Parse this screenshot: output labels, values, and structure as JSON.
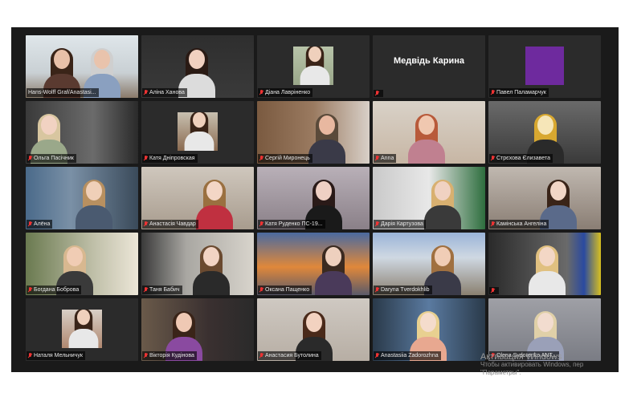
{
  "window_title": "",
  "participants": [
    {
      "name": "Hans-Wolff Graf/Anastasi...",
      "muted": false,
      "active": true
    },
    {
      "name": "Аліна Ханова",
      "muted": true
    },
    {
      "name": "Діана Лавріненко",
      "muted": true
    },
    {
      "name": "",
      "muted": true,
      "display_name": "Медвідь Карина"
    },
    {
      "name": "Павел Паламарчук",
      "muted": true
    },
    {
      "name": "Ольга Пасічник",
      "muted": true
    },
    {
      "name": "Катя Дніпровская",
      "muted": true
    },
    {
      "name": "Сергій Миронець",
      "muted": true
    },
    {
      "name": "Anna",
      "muted": true
    },
    {
      "name": "Стрєхова Єлизавета",
      "muted": true
    },
    {
      "name": "Алёна",
      "muted": true
    },
    {
      "name": "Анастасія Чавдар",
      "muted": true
    },
    {
      "name": "Катя Руденко ПС-19...",
      "muted": true
    },
    {
      "name": "Дарія Картузова",
      "muted": true
    },
    {
      "name": "Камінська Ангеліна",
      "muted": true
    },
    {
      "name": "Богдана Боброва",
      "muted": true
    },
    {
      "name": "Таня Бабич",
      "muted": true
    },
    {
      "name": "Оксана Пащенко",
      "muted": true
    },
    {
      "name": "Daryna Tverdokhlib",
      "muted": true
    },
    {
      "name": "",
      "muted": true
    },
    {
      "name": "Наталя Мельничук",
      "muted": true
    },
    {
      "name": "Вікторія Кудінова",
      "muted": true
    },
    {
      "name": "Анастасия Бутолина",
      "muted": true
    },
    {
      "name": "Anastasiia Zadorozhna",
      "muted": true
    },
    {
      "name": "Olena Sydorenko ANT...",
      "muted": true
    }
  ],
  "watermark": {
    "title": "Активация Windows",
    "line1": "Чтобы активировать Windows, пер",
    "line2": "\"Параметры\"."
  }
}
